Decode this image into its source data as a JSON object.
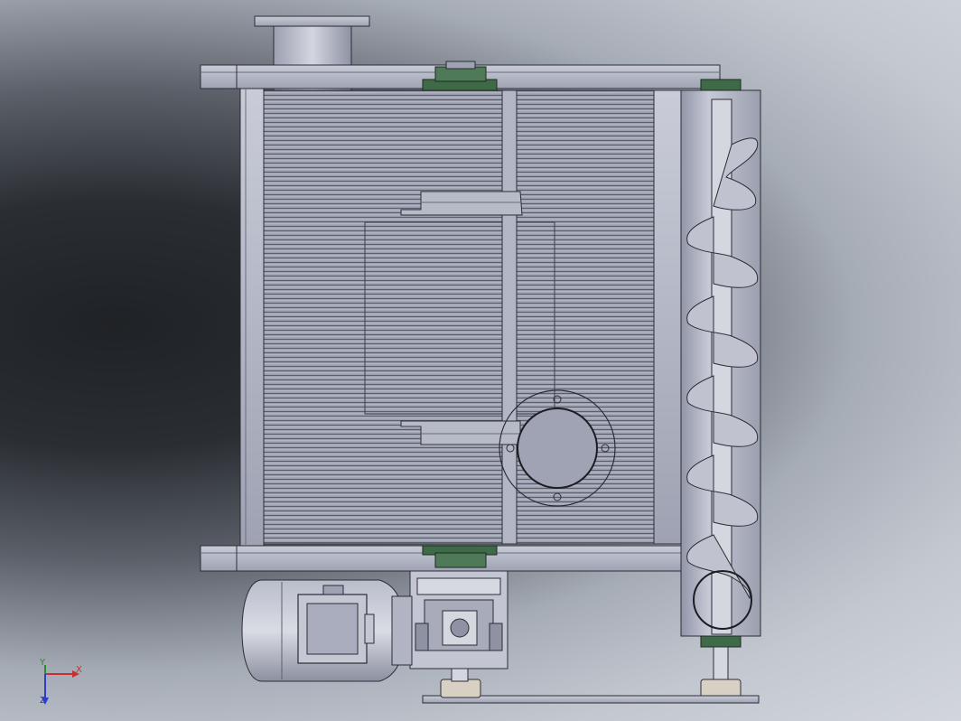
{
  "viewport": {
    "background_colors": [
      "#1f2226",
      "#5b6069",
      "#c3c8d0"
    ],
    "part_fill": "#a9adbd",
    "part_stroke": "#2b2d36",
    "bearing_color": "#3f6a48"
  },
  "triad": {
    "x_label": "X",
    "y_label": "Y",
    "z_label": "Z",
    "x_color": "#c83030",
    "y_color": "#2a8a2a",
    "z_color": "#2c3fc8"
  }
}
